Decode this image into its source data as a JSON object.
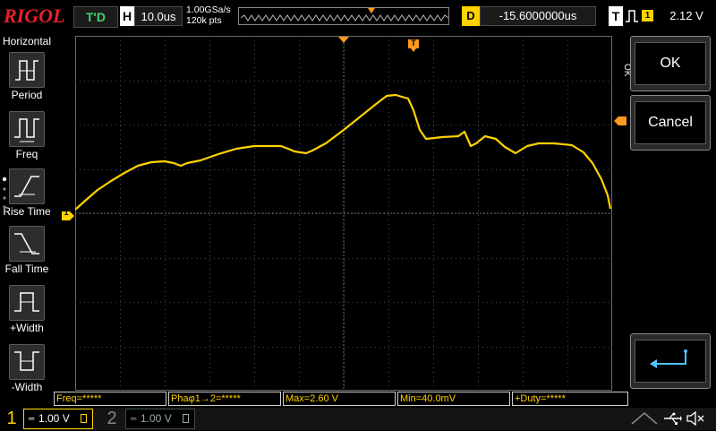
{
  "brand": "RIGOL",
  "top_bar": {
    "run_status": "T'D",
    "horizontal_label": "H",
    "timebase": "10.0us",
    "sample_rate": "1.00GSa/s",
    "memory_depth": "120k pts",
    "delay_label": "D",
    "delay_value": "-15.6000000us",
    "trigger_label": "T",
    "trigger_source": "1",
    "trigger_level": "2.12 V"
  },
  "left_menu": {
    "title": "Horizontal",
    "items": [
      {
        "label": "Period",
        "icon": "period-icon"
      },
      {
        "label": "Freq",
        "icon": "frequency-icon"
      },
      {
        "label": "Rise Time",
        "icon": "rise-time-icon"
      },
      {
        "label": "Fall Time",
        "icon": "fall-time-icon"
      },
      {
        "label": "+Width",
        "icon": "positive-width-icon"
      },
      {
        "label": "-Width",
        "icon": "negative-width-icon"
      }
    ]
  },
  "right_menu": {
    "side_label": "OK",
    "ok_label": "OK",
    "cancel_label": "Cancel",
    "enter_icon": "enter-return-icon"
  },
  "screen": {
    "trigger_marker": "T",
    "channel_marker": "1"
  },
  "measurements": [
    {
      "label": "Freq=*****"
    },
    {
      "label": "Phaφ1→2=*****"
    },
    {
      "label": "Max=2.60 V"
    },
    {
      "label": "Min=40.0mV"
    },
    {
      "label": "+Duty=*****"
    }
  ],
  "bottom_bar": {
    "ch1_number": "1",
    "ch1_scale": "1.00 V",
    "ch2_number": "2",
    "ch2_scale": "1.00 V",
    "status_icons": [
      "usb-icon",
      "mute-speaker-icon"
    ]
  },
  "colors": {
    "trace": "#ffd200",
    "brand": "#e8202a",
    "run_status": "#3cd46a",
    "grid": "#5a5a5a",
    "trigger_marker": "#ff9a1f"
  }
}
